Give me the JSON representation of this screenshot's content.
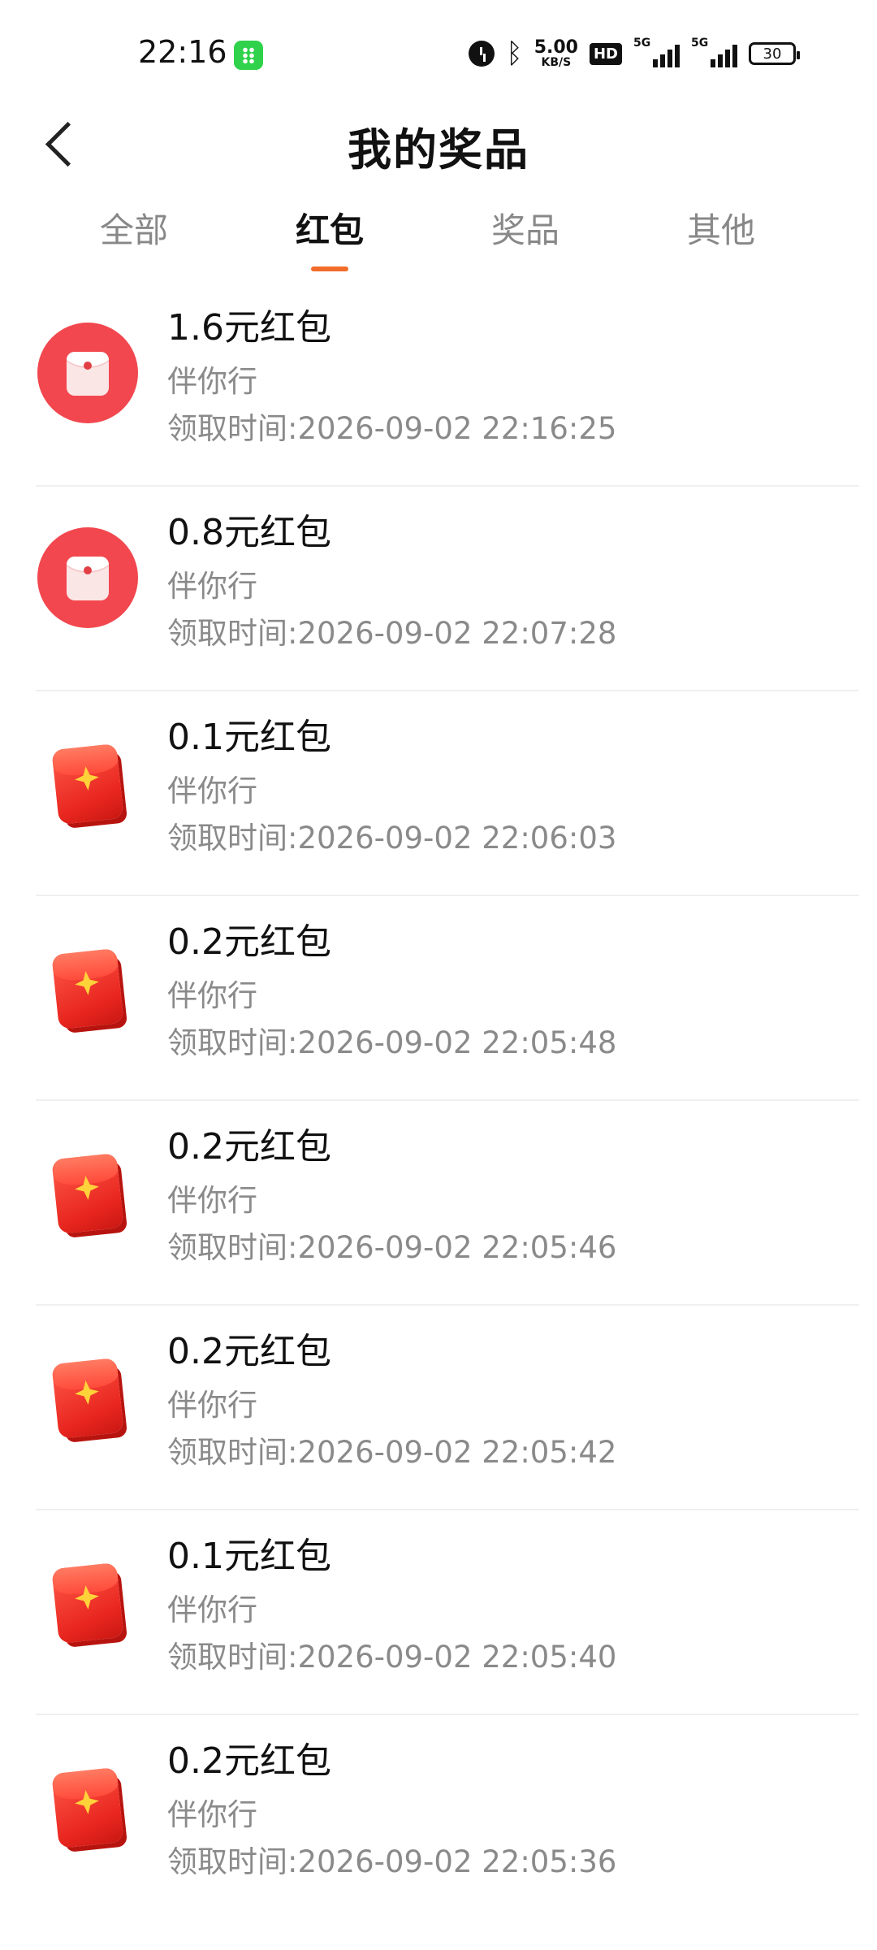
{
  "status_bar": {
    "time": "22:16",
    "net_speed_value": "5.00",
    "net_speed_unit": "KB/S",
    "hd_label": "HD",
    "signal1_label": "5G",
    "signal2_label": "5G",
    "battery": "30",
    "icons": [
      "app-badge-icon",
      "alarm-icon",
      "bluetooth-icon",
      "hd-icon",
      "signal-icon",
      "signal-icon",
      "battery-icon"
    ]
  },
  "nav": {
    "title": "我的奖品",
    "back_icon": "chevron-left-icon"
  },
  "tabs": [
    {
      "label": "全部",
      "active": false
    },
    {
      "label": "红包",
      "active": true
    },
    {
      "label": "奖品",
      "active": false
    },
    {
      "label": "其他",
      "active": false
    }
  ],
  "accent_color": "#f26c2a",
  "items": [
    {
      "title": "1.6元红包",
      "source": "伴你行",
      "time": "领取时间:2026-09-02 22:16:25",
      "icon": "round-red-envelope-icon"
    },
    {
      "title": "0.8元红包",
      "source": "伴你行",
      "time": "领取时间:2026-09-02 22:07:28",
      "icon": "round-red-envelope-icon"
    },
    {
      "title": "0.1元红包",
      "source": "伴你行",
      "time": "领取时间:2026-09-02 22:06:03",
      "icon": "red-envelope-icon"
    },
    {
      "title": "0.2元红包",
      "source": "伴你行",
      "time": "领取时间:2026-09-02 22:05:48",
      "icon": "red-envelope-icon"
    },
    {
      "title": "0.2元红包",
      "source": "伴你行",
      "time": "领取时间:2026-09-02 22:05:46",
      "icon": "red-envelope-icon"
    },
    {
      "title": "0.2元红包",
      "source": "伴你行",
      "time": "领取时间:2026-09-02 22:05:42",
      "icon": "red-envelope-icon"
    },
    {
      "title": "0.1元红包",
      "source": "伴你行",
      "time": "领取时间:2026-09-02 22:05:40",
      "icon": "red-envelope-icon"
    },
    {
      "title": "0.2元红包",
      "source": "伴你行",
      "time": "领取时间:2026-09-02 22:05:36",
      "icon": "red-envelope-icon"
    }
  ]
}
